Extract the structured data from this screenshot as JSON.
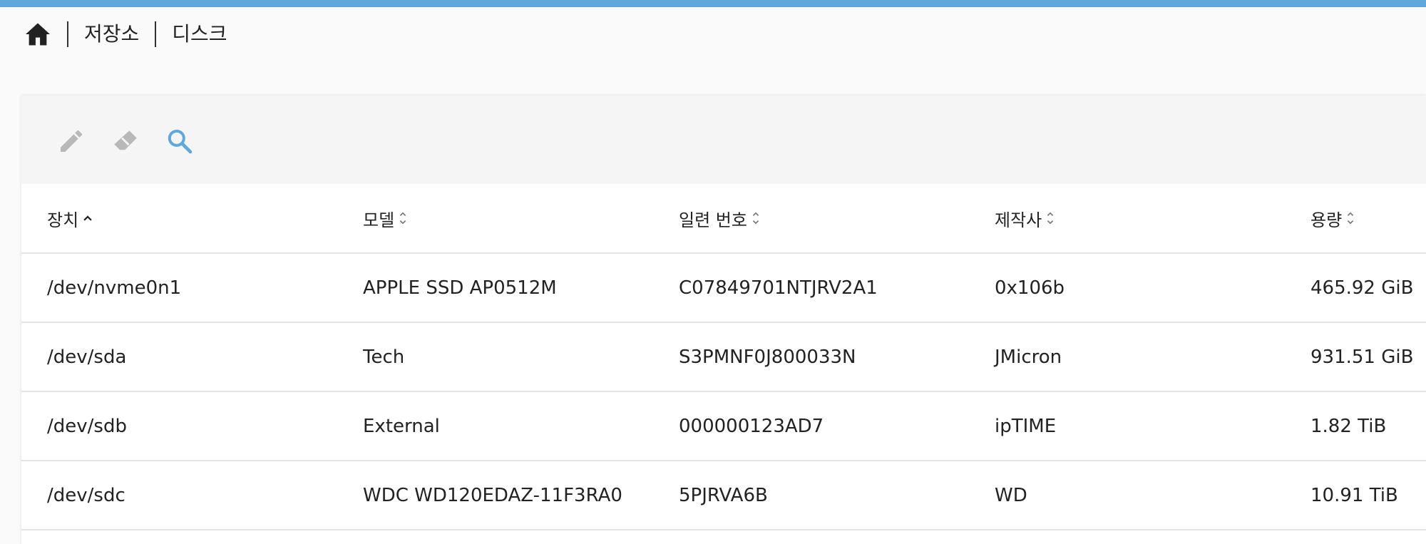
{
  "breadcrumb": {
    "home_icon": "home-icon",
    "items": [
      "저장소",
      "디스크"
    ]
  },
  "toolbar": {
    "edit_icon": "pencil-icon",
    "clear_icon": "eraser-icon",
    "search_icon": "search-icon",
    "accent_color": "#5fa8dc",
    "disabled_color": "#b8b8b8"
  },
  "table": {
    "columns": [
      {
        "label": "장치",
        "sort": "ascending"
      },
      {
        "label": "모델",
        "sort": "none"
      },
      {
        "label": "일련 번호",
        "sort": "none"
      },
      {
        "label": "제작사",
        "sort": "none"
      },
      {
        "label": "용량",
        "sort": "none"
      }
    ],
    "rows": [
      [
        "/dev/nvme0n1",
        "APPLE SSD AP0512M",
        "C07849701NTJRV2A1",
        "0x106b",
        "465.92 GiB"
      ],
      [
        "/dev/sda",
        "Tech",
        "S3PMNF0J800033N",
        "JMicron",
        "931.51 GiB"
      ],
      [
        "/dev/sdb",
        "External",
        "000000123AD7",
        "ipTIME",
        "1.82 TiB"
      ],
      [
        "/dev/sdc",
        "WDC WD120EDAZ-11F3RA0",
        "5PJRVA6B",
        "WD",
        "10.91 TiB"
      ]
    ]
  },
  "colors": {
    "top_bar": "#5fa8dc",
    "page_bg": "#fafafa",
    "toolbar_bg": "#f5f5f5"
  }
}
